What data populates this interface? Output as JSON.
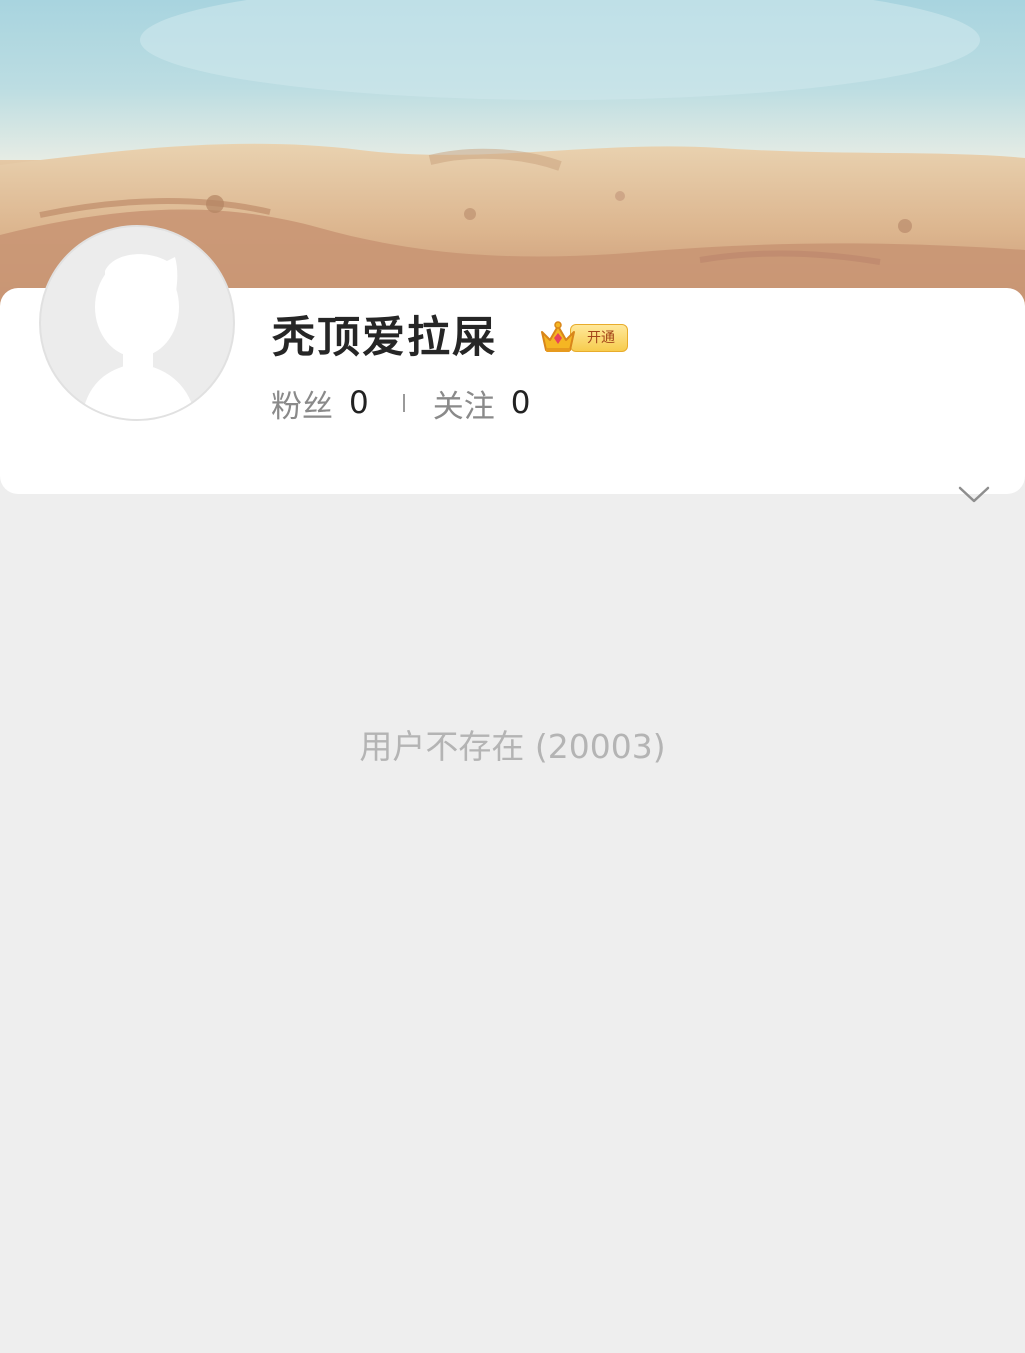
{
  "profile": {
    "username": "秃顶爱拉屎",
    "vip_badge": {
      "label": "开通",
      "icon": "crown-icon"
    },
    "stats": {
      "fans_label": "粉丝",
      "fans_count": "0",
      "following_label": "关注",
      "following_count": "0"
    },
    "avatar": "default-avatar-icon",
    "expand_icon": "chevron-down-icon"
  },
  "main": {
    "error_message": "用户不存在 (20003)"
  },
  "colors": {
    "background": "#eeeeee",
    "card": "#ffffff",
    "username": "#262626",
    "error_text": "#b4b4b4",
    "vip_gold": "#f7cc4e"
  }
}
